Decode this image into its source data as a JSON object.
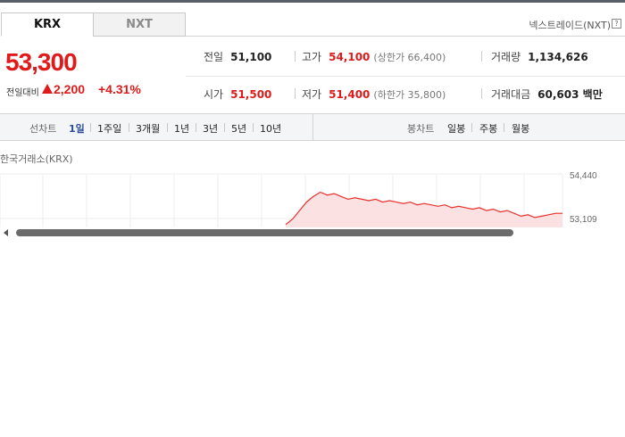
{
  "tabs": [
    {
      "label": "KRX",
      "active": true
    },
    {
      "label": "NXT",
      "active": false
    }
  ],
  "nxt_link": {
    "label": "넥스트레이드(NXT)",
    "icon": "help-icon"
  },
  "price": {
    "current": "53,300",
    "change_label": "전일대비",
    "change_value": "2,200",
    "change_pct": "+4.31%",
    "direction_icon": "up-triangle-icon",
    "color": "#e01a1a"
  },
  "stats": {
    "prev_close": {
      "label": "전일",
      "value": "51,100"
    },
    "high": {
      "label": "고가",
      "value": "54,100",
      "sub": "(상한가 66,400)"
    },
    "volume": {
      "label": "거래량",
      "value": "1,134,626"
    },
    "open": {
      "label": "시가",
      "value": "51,500"
    },
    "low": {
      "label": "저가",
      "value": "51,400",
      "sub": "(하한가 35,800)"
    },
    "amount": {
      "label": "거래대금",
      "value": "60,603 백만"
    }
  },
  "chart_controls": {
    "line_label": "선차트",
    "line_periods": [
      "1일",
      "1주일",
      "3개월",
      "1년",
      "3년",
      "5년",
      "10년"
    ],
    "active_period": "1일",
    "candle_label": "봉차트",
    "candle_periods": [
      "일봉",
      "주봉",
      "월봉"
    ]
  },
  "chart_data": {
    "type": "area",
    "title": "한국거래소(KRX)",
    "ytick_labels": [
      "54,440",
      "53,109"
    ],
    "ylim": [
      52800,
      54700
    ],
    "color": "#e5322d",
    "fill": "#fbe1e1",
    "x": [
      0,
      1,
      2,
      3,
      4,
      5,
      6,
      7,
      8,
      9,
      10,
      11,
      12,
      13,
      14,
      15,
      16,
      17,
      18,
      19,
      20,
      21,
      22,
      23,
      24,
      25,
      26,
      27,
      28,
      29,
      30,
      31,
      32,
      33,
      34,
      35,
      36,
      37,
      38,
      39,
      40
    ],
    "values": [
      52900,
      53100,
      53400,
      53700,
      53900,
      54050,
      53950,
      54000,
      53900,
      53800,
      53850,
      53800,
      53750,
      53800,
      53700,
      53750,
      53700,
      53650,
      53700,
      53600,
      53650,
      53600,
      53550,
      53600,
      53500,
      53550,
      53500,
      53450,
      53500,
      53400,
      53450,
      53350,
      53400,
      53300,
      53200,
      53250,
      53150,
      53200,
      53250,
      53300,
      53300
    ]
  },
  "scrollbar": {
    "left_arrow": "left-arrow-icon"
  }
}
